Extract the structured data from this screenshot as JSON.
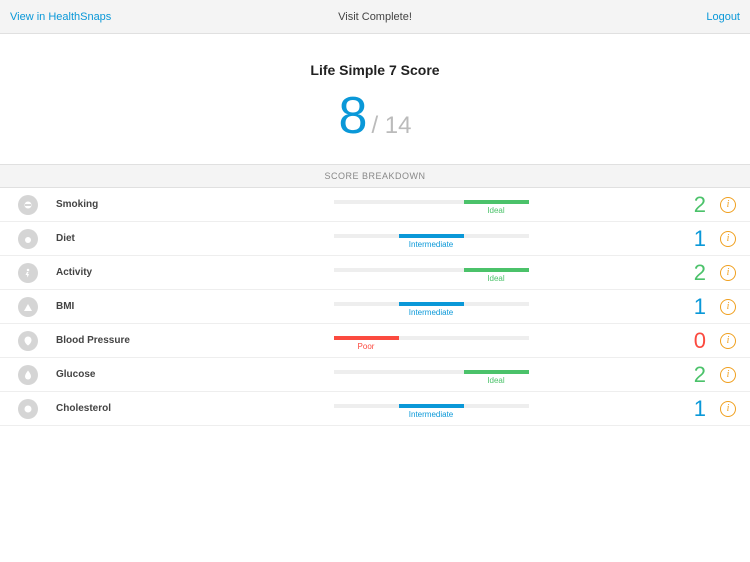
{
  "header": {
    "left": "View in HealthSnaps",
    "center": "Visit Complete!",
    "right": "Logout"
  },
  "score": {
    "title": "Life Simple 7 Score",
    "value": "8",
    "divider": " / 14"
  },
  "breakdown_title": "SCORE BREAKDOWN",
  "metrics": [
    {
      "name": "Smoking",
      "status": "Ideal",
      "value": "2",
      "cls": "ideal"
    },
    {
      "name": "Diet",
      "status": "Intermediate",
      "value": "1",
      "cls": "inter"
    },
    {
      "name": "Activity",
      "status": "Ideal",
      "value": "2",
      "cls": "ideal"
    },
    {
      "name": "BMI",
      "status": "Intermediate",
      "value": "1",
      "cls": "inter"
    },
    {
      "name": "Blood Pressure",
      "status": "Poor",
      "value": "0",
      "cls": "poor"
    },
    {
      "name": "Glucose",
      "status": "Ideal",
      "value": "2",
      "cls": "ideal"
    },
    {
      "name": "Cholesterol",
      "status": "Intermediate",
      "value": "1",
      "cls": "inter"
    }
  ],
  "info_glyph": "i"
}
